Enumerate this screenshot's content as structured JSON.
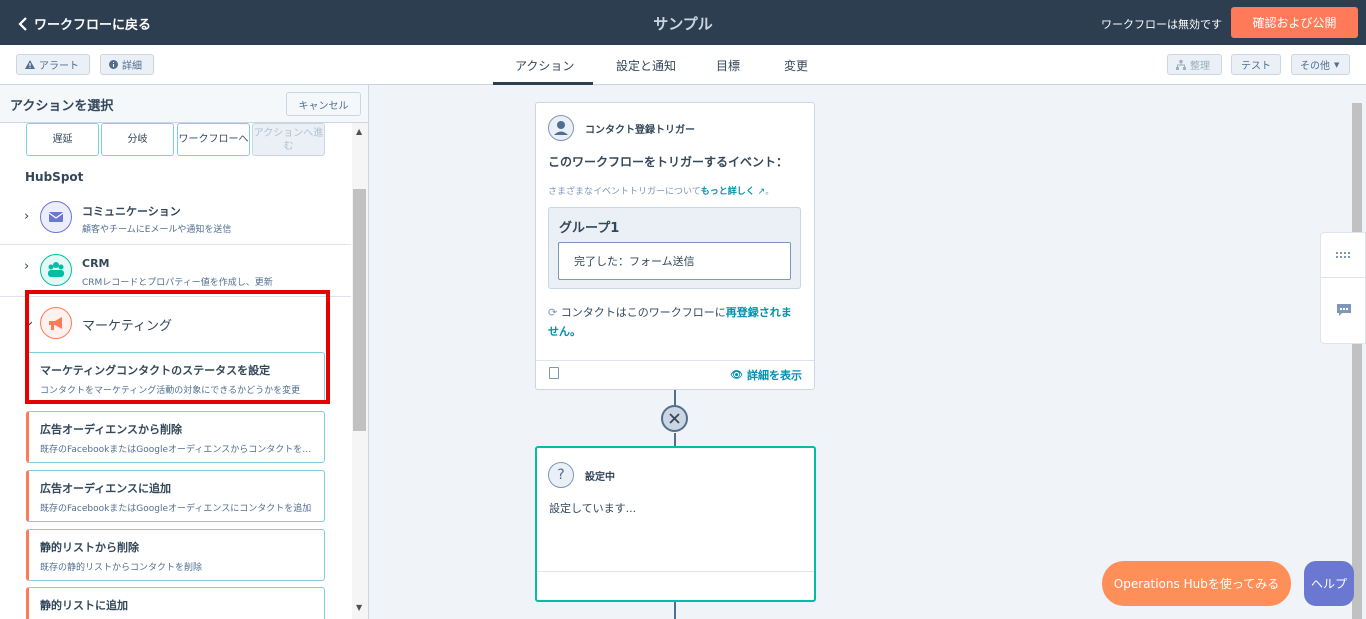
{
  "topbar": {
    "back_label": "ワークフローに戻る",
    "title": "サンプル",
    "status": "ワークフローは無効です",
    "publish_label": "確認および公開"
  },
  "subbar": {
    "alert_label": "アラート",
    "details_label": "詳細",
    "tabs": [
      {
        "label": "アクション",
        "active": true
      },
      {
        "label": "設定と通知",
        "active": false
      },
      {
        "label": "目標",
        "active": false
      },
      {
        "label": "変更",
        "active": false
      }
    ],
    "organize_label": "整理",
    "test_label": "テスト",
    "more_label": "その他"
  },
  "panel": {
    "title": "アクションを選択",
    "cancel_label": "キャンセル",
    "tiles": [
      {
        "label": "遅延",
        "disabled": false
      },
      {
        "label": "分岐",
        "disabled": false
      },
      {
        "label": "ワークフローへ",
        "disabled": false
      },
      {
        "label": "アクションへ進む",
        "disabled": true
      }
    ],
    "section_label": "HubSpot",
    "categories": [
      {
        "name": "コミュニケーション",
        "desc": "顧客やチームにEメールや通知を送信",
        "icon": "mail-icon",
        "color": "#6a78d1"
      },
      {
        "name": "CRM",
        "desc": "CRMレコードとプロパティー値を作成し、更新",
        "icon": "people-icon",
        "color": "#00bda5"
      },
      {
        "name": "マーケティング",
        "desc": "",
        "icon": "megaphone-icon",
        "color": "#ff7a59"
      }
    ],
    "actions": [
      {
        "title": "マーケティングコンタクトのステータスを設定",
        "desc": "コンタクトをマーケティング活動の対象にできるかどうかを変更"
      },
      {
        "title": "広告オーディエンスから削除",
        "desc": "既存のFacebookまたはGoogleオーディエンスからコンタクトを削除"
      },
      {
        "title": "広告オーディエンスに追加",
        "desc": "既存のFacebookまたはGoogleオーディエンスにコンタクトを追加"
      },
      {
        "title": "静的リストから削除",
        "desc": "既存の静的リストからコンタクトを削除"
      },
      {
        "title": "静的リストに追加",
        "desc": ""
      }
    ]
  },
  "trigger": {
    "header": "コンタクト登録トリガー",
    "heading": "このワークフローをトリガーするイベント：",
    "learn_prefix": "さまざまなイベントトリガーについて",
    "learn_link": "もっと詳しく",
    "group_title": "グループ1",
    "condition": "完了した：フォーム送信",
    "reenroll_prefix": "コンタクトはこのワークフローに",
    "reenroll_link": "再登録されません。",
    "view_details": "詳細を表示"
  },
  "setup": {
    "title": "設定中",
    "body": "設定しています..."
  },
  "footer": {
    "ops_label": "Operations Hubを使ってみる",
    "help_label": "ヘルプ"
  }
}
